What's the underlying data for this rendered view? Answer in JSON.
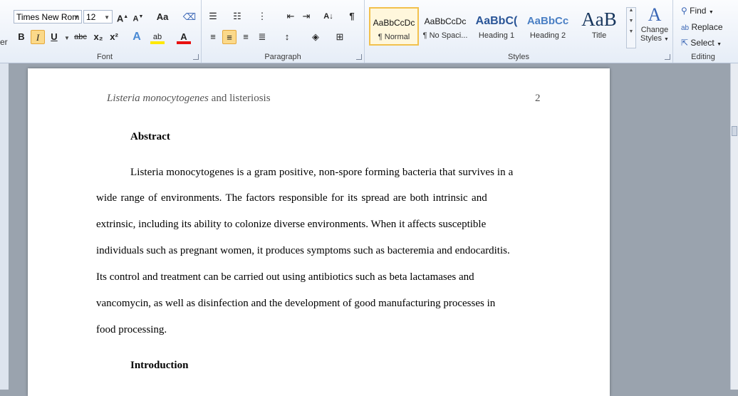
{
  "ribbon": {
    "font_group": {
      "label": "Font",
      "font_name": "Times New Rom",
      "font_size": "12",
      "grow_label": "A",
      "shrink_label": "A",
      "change_case_label": "Aa",
      "bold": "B",
      "italic": "I",
      "underline": "U",
      "strike": "abc",
      "subscript": "x₂",
      "superscript": "x²",
      "font_color": "A"
    },
    "paragraph_group": {
      "label": "Paragraph",
      "pilcrow": "¶"
    },
    "styles_group": {
      "label": "Styles",
      "items": [
        {
          "sample": "AaBbCcDc",
          "name": "¶ Normal"
        },
        {
          "sample": "AaBbCcDc",
          "name": "¶ No Spaci..."
        },
        {
          "sample": "AaBbC(",
          "name": "Heading 1"
        },
        {
          "sample": "AaBbCc",
          "name": "Heading 2"
        },
        {
          "sample": "AaB",
          "name": "Title"
        }
      ],
      "change_styles": [
        "Change",
        "Styles"
      ]
    },
    "editing_group": {
      "label": "Editing",
      "find": "Find",
      "replace": "Replace",
      "select": "Select"
    },
    "left_cut": "er"
  },
  "document": {
    "header_italic": "Listeria monocytogenes",
    "header_rest": " and listeriosis",
    "page_number": "2",
    "abstract_heading": "Abstract",
    "lines": [
      "Listeria monocytogenes is a gram positive, non-spore forming bacteria that survives in a",
      "wide range of environments. The factors responsible  for its spread are both intrinsic  and",
      "extrinsic, including its ability to colonize diverse environments. When it affects susceptible",
      "individuals such as pregnant women, it produces symptoms such as bacteremia and endocarditis.",
      "Its control and treatment can be carried out using antibiotics such as beta lactamases and",
      "vancomycin, as well as disinfection and the development of good manufacturing processes in",
      "food processing."
    ],
    "intro_heading": "Introduction"
  }
}
